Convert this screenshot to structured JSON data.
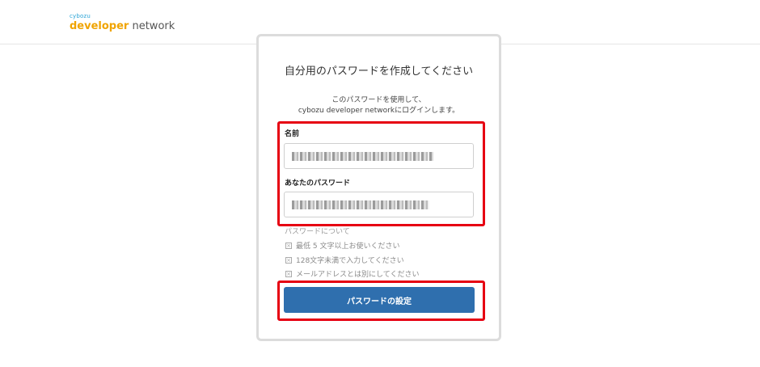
{
  "brand": {
    "small": "cybozu",
    "main_highlight": "developer",
    "main_rest": " network"
  },
  "form": {
    "title": "自分用のパスワードを作成してください",
    "description_line1": "このパスワードを使用して、",
    "description_line2": "cybozu developer networkにログインします。",
    "name_label": "名前",
    "password_label": "あなたのパスワード",
    "password_info_heading": "パスワードについて",
    "rules": [
      "最低 5 文字以上お使いください",
      "128文字未満で入力してください",
      "メールアドレスとは別にしてください"
    ],
    "submit_label": "パスワードの設定"
  },
  "colors": {
    "accent_button": "#2f6fae",
    "highlight_border": "#e60012",
    "brand_orange": "#f0a400",
    "brand_blue": "#29a3d6"
  }
}
